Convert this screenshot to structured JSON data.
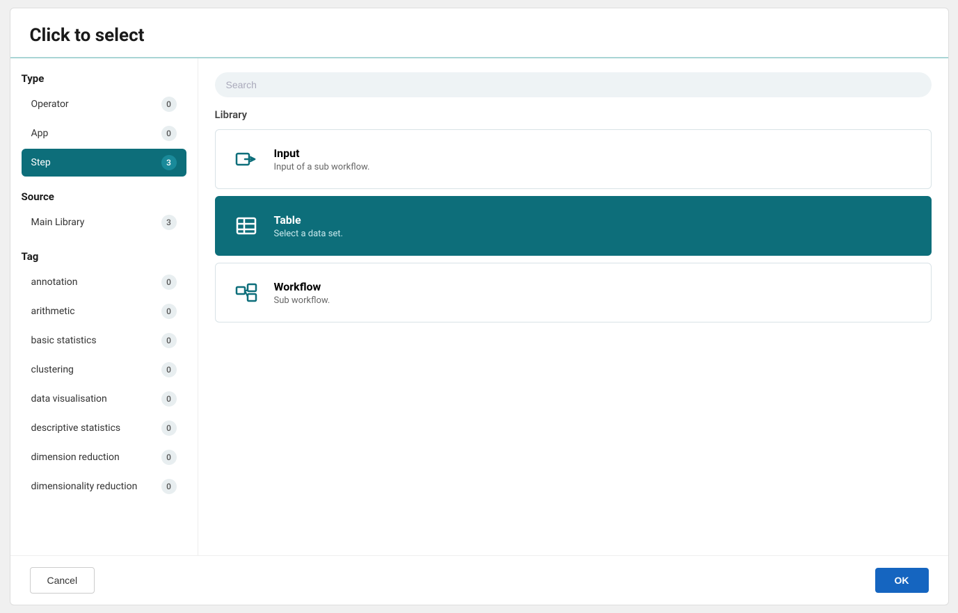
{
  "dialog": {
    "title": "Click to select"
  },
  "search": {
    "placeholder": "Search"
  },
  "library_label": "Library",
  "type_section": {
    "label": "Type",
    "items": [
      {
        "id": "operator",
        "label": "Operator",
        "count": "0",
        "active": false
      },
      {
        "id": "app",
        "label": "App",
        "count": "0",
        "active": false
      },
      {
        "id": "step",
        "label": "Step",
        "count": "3",
        "active": true
      }
    ]
  },
  "source_section": {
    "label": "Source",
    "items": [
      {
        "id": "main-library",
        "label": "Main Library",
        "count": "3",
        "active": false
      }
    ]
  },
  "tag_section": {
    "label": "Tag",
    "items": [
      {
        "id": "annotation",
        "label": "annotation",
        "count": "0",
        "active": false
      },
      {
        "id": "arithmetic",
        "label": "arithmetic",
        "count": "0",
        "active": false
      },
      {
        "id": "basic-statistics",
        "label": "basic statistics",
        "count": "0",
        "active": false
      },
      {
        "id": "clustering",
        "label": "clustering",
        "count": "0",
        "active": false
      },
      {
        "id": "data-visualisation",
        "label": "data visualisation",
        "count": "0",
        "active": false
      },
      {
        "id": "descriptive-statistics",
        "label": "descriptive statistics",
        "count": "0",
        "active": false
      },
      {
        "id": "dimension-reduction",
        "label": "dimension reduction",
        "count": "0",
        "active": false
      },
      {
        "id": "dimensionality-reduction",
        "label": "dimensionality reduction",
        "count": "0",
        "active": false
      }
    ]
  },
  "library_items": [
    {
      "id": "input",
      "title": "Input",
      "description": "Input of a sub workflow.",
      "icon": "input",
      "selected": false
    },
    {
      "id": "table",
      "title": "Table",
      "description": "Select a data set.",
      "icon": "table",
      "selected": true
    },
    {
      "id": "workflow",
      "title": "Workflow",
      "description": "Sub workflow.",
      "icon": "workflow",
      "selected": false
    }
  ],
  "footer": {
    "cancel_label": "Cancel",
    "ok_label": "OK"
  }
}
